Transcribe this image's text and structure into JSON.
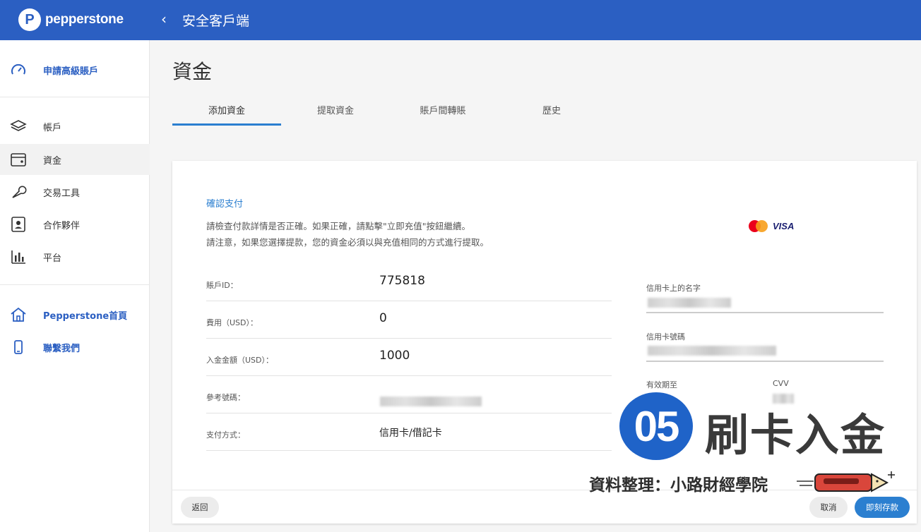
{
  "app": {
    "logo_text": "pepperstone",
    "logo_mark": "P",
    "back_icon": "‹",
    "title": "安全客戶端"
  },
  "sidebar": {
    "items": [
      {
        "label": "申請高級賬戶",
        "icon": "gauge-icon",
        "style": "blue"
      },
      {
        "label": "帳戶",
        "icon": "layers-icon"
      },
      {
        "label": "資金",
        "icon": "wallet-icon",
        "active": true
      },
      {
        "label": "交易工具",
        "icon": "wrench-icon"
      },
      {
        "label": "合作夥伴",
        "icon": "person-badge-icon"
      },
      {
        "label": "平台",
        "icon": "bar-chart-icon"
      },
      {
        "label": "Pepperstone首頁",
        "icon": "home-icon",
        "style": "blue"
      },
      {
        "label": "聯繫我們",
        "icon": "phone-icon",
        "style": "blue"
      }
    ]
  },
  "main": {
    "page_title": "資金",
    "tabs": [
      {
        "label": "添加資金",
        "active": true
      },
      {
        "label": "提取資金"
      },
      {
        "label": "賬戶間轉賬"
      },
      {
        "label": "歷史"
      }
    ]
  },
  "confirm": {
    "title": "確認支付",
    "note_1": "請檢查付款詳情是否正確。如果正確，請點擊\"立即充值\"按鈕繼續。",
    "note_2": "請注意，如果您選擇提款，您的資金必須以與充值相同的方式進行提取。",
    "card_brand": "VISA",
    "rows": [
      {
        "label": "賬戶ID：",
        "value": "775818"
      },
      {
        "label": "費用（USD）：",
        "value": "0"
      },
      {
        "label": "入金金額（USD）：",
        "value": "1000"
      },
      {
        "label": "參考號碼：",
        "value": ""
      },
      {
        "label": "支付方式：",
        "value": "信用卡/借記卡"
      }
    ],
    "card_fields": {
      "name_label": "信用卡上的名字",
      "number_label": "信用卡號碼",
      "expiry_label": "有效期至",
      "cvv_label": "CVV"
    },
    "buttons": {
      "back": "返回",
      "cancel": "取消",
      "deposit": "即刻存款"
    }
  },
  "overlay": {
    "step_number": "05",
    "step_title": "刷卡入金",
    "credit": "資料整理：小路財經學院"
  },
  "colors": {
    "brand_blue": "#2b5fc2",
    "accent_blue": "#2b7fd0",
    "overlay_blue": "#1f63c8"
  }
}
